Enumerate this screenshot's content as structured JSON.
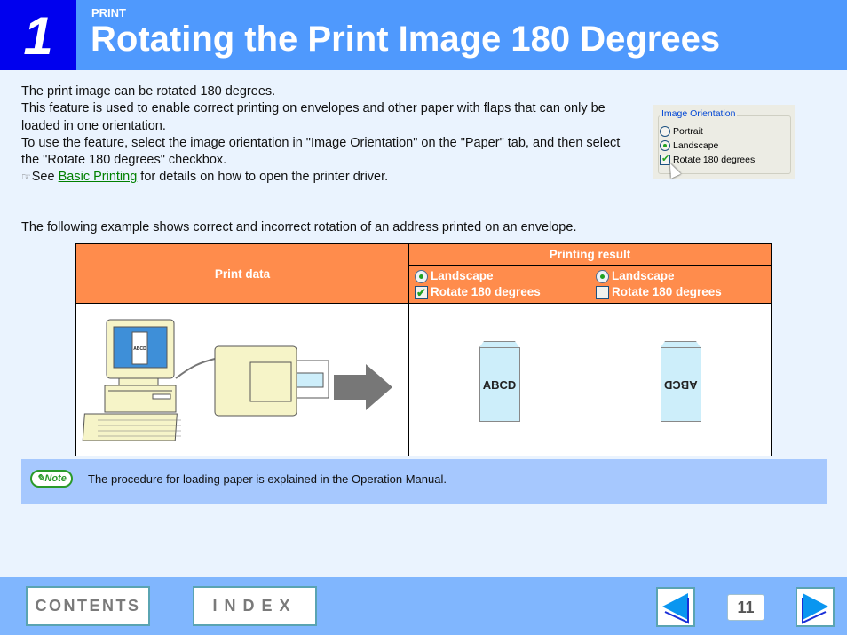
{
  "header": {
    "chapter_number": "1",
    "section": "PRINT",
    "title": "Rotating the Print Image 180 Degrees"
  },
  "intro": {
    "line1": "The print image can be rotated 180 degrees.",
    "line2": "This feature is used to enable correct printing on envelopes and other paper with flaps that can only be loaded in one orientation.",
    "line3": "To use the feature, select the image orientation in \"Image Orientation\" on the \"Paper\" tab, and then select the \"Rotate 180 degrees\" checkbox.",
    "ref_prefix": "See",
    "ref_link": "Basic Printing",
    "ref_suffix": "for details on how to open the printer driver."
  },
  "dialog": {
    "group_label": "Image Orientation",
    "options": [
      {
        "label": "Portrait",
        "type": "radio",
        "checked": false
      },
      {
        "label": "Landscape",
        "type": "radio",
        "checked": true
      },
      {
        "label": "Rotate 180 degrees",
        "type": "checkbox",
        "checked": true
      }
    ]
  },
  "example_text": "The following example shows correct and incorrect rotation of an address printed on an envelope.",
  "table": {
    "col_print_data": "Print data",
    "col_printing_result": "Printing result",
    "results": [
      {
        "orientation": "Landscape",
        "orientation_selected": true,
        "rotate_label": "Rotate 180 degrees",
        "rotate_checked": true,
        "envelope_text": "ABCD",
        "rotated": false
      },
      {
        "orientation": "Landscape",
        "orientation_selected": true,
        "rotate_label": "Rotate 180 degrees",
        "rotate_checked": false,
        "envelope_text": "ABCD",
        "rotated": true
      }
    ],
    "screen_text": "ABCD"
  },
  "note": {
    "badge": "Note",
    "text": "The procedure for loading paper is explained in the Operation Manual."
  },
  "footer": {
    "contents_label": "CONTENTS",
    "index_label": "INDEX",
    "page_number": "11"
  },
  "colors": {
    "header_bg": "#4f99fd",
    "chapter_bg": "#0000ee",
    "table_header": "#ff8c4c",
    "note_bg": "#a6c8fe",
    "footer_bg": "#80b6fe",
    "link": "#008000"
  }
}
